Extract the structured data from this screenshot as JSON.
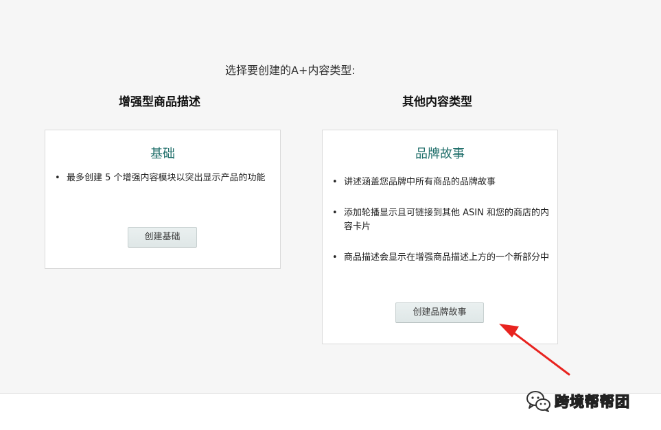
{
  "prompt": "选择要创建的A+内容类型:",
  "columns": {
    "enhanced": {
      "heading": "增强型商品描述",
      "card": {
        "title": "基础",
        "bullets": [
          "最多创建 5 个增强内容模块以突出显示产品的功能"
        ],
        "button_label": "创建基础"
      }
    },
    "other": {
      "heading": "其他内容类型",
      "card": {
        "title": "品牌故事",
        "bullets": [
          "讲述涵盖您品牌中所有商品的品牌故事",
          "添加轮播显示且可链接到其他 ASIN 和您的商店的内容卡片",
          "商品描述会显示在增强商品描述上方的一个新部分中"
        ],
        "button_label": "创建品牌故事"
      }
    }
  },
  "watermark": {
    "text": "跨境帮帮团",
    "icon": "wechat-icon"
  },
  "colors": {
    "panel_background": "#f6f6f6",
    "card_title": "#1f6e6a",
    "arrow": "#e8231f"
  }
}
